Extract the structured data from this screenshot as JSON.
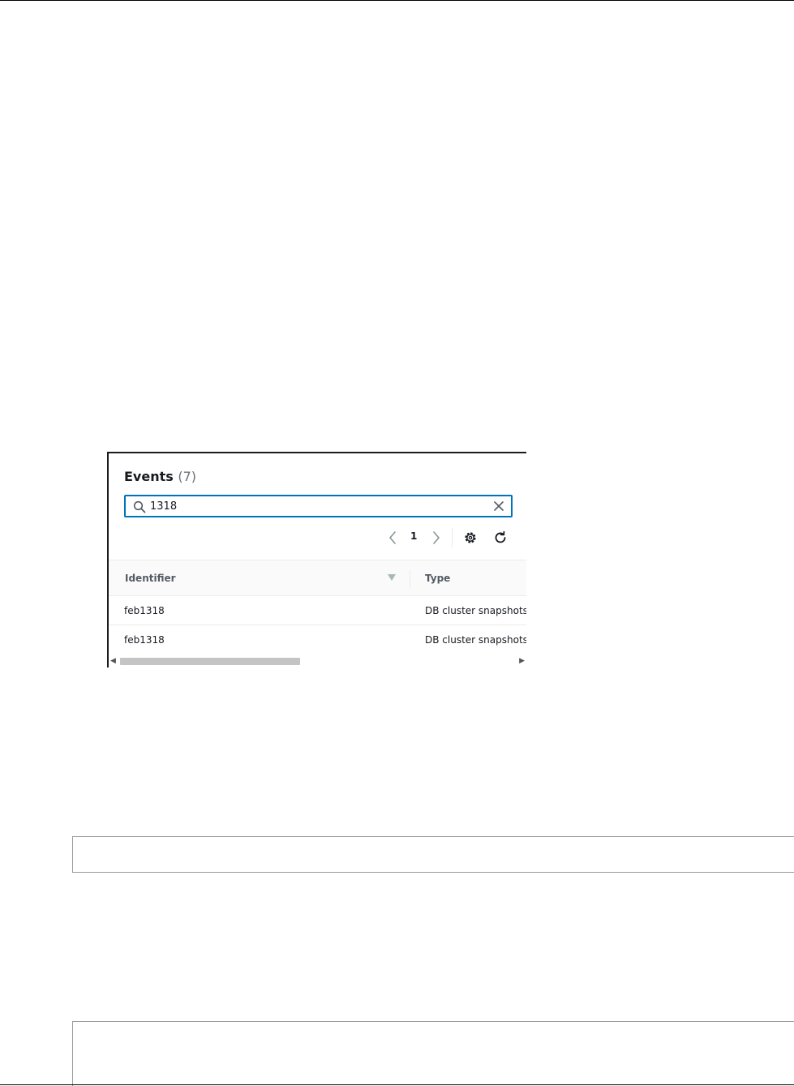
{
  "events_panel": {
    "title": "Events",
    "count": "(7)",
    "search": {
      "value": "1318"
    },
    "pagination": {
      "current_page": "1"
    },
    "table": {
      "columns": [
        "Identifier",
        "Type"
      ],
      "rows": [
        {
          "identifier": "feb1318",
          "type": "DB cluster snapshots"
        },
        {
          "identifier": "feb1318",
          "type": "DB cluster snapshots"
        }
      ]
    },
    "icons": {
      "search": "search-icon",
      "clear": "close-icon",
      "prev": "chevron-left-icon",
      "next": "chevron-right-icon",
      "settings": "gear-icon",
      "refresh": "refresh-icon",
      "sort": "sort-down-icon"
    },
    "colors": {
      "focus_border": "#0073bb",
      "header_bg": "#fafafa"
    }
  }
}
